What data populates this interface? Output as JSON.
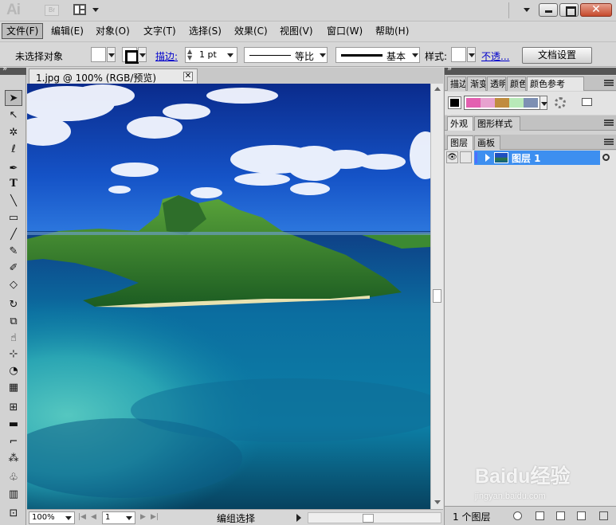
{
  "app": {
    "logo": "Ai",
    "bridge_label": "Br"
  },
  "menu": [
    {
      "label": "文件(F)",
      "active": true
    },
    {
      "label": "编辑(E)"
    },
    {
      "label": "对象(O)"
    },
    {
      "label": "文字(T)"
    },
    {
      "label": "选择(S)"
    },
    {
      "label": "效果(C)"
    },
    {
      "label": "视图(V)"
    },
    {
      "label": "窗口(W)"
    },
    {
      "label": "帮助(H)"
    }
  ],
  "control": {
    "selection_label": "未选择对象",
    "stroke_label": "描边:",
    "stroke_weight": "1 pt",
    "profile_label": "等比",
    "brush_label": "基本",
    "style_label": "样式:",
    "opacity_label": "不透...",
    "doc_setup_button": "文档设置"
  },
  "document": {
    "tab_title": "1.jpg @ 100% (RGB/预览)",
    "close_glyph": "✕"
  },
  "tools": [
    "selection-tool",
    "direct-selection-tool",
    "magic-wand-tool",
    "lasso-tool",
    "pen-tool",
    "type-tool",
    "line-tool",
    "rectangle-tool",
    "paintbrush-tool",
    "pencil-tool",
    "blob-brush-tool",
    "eraser-tool",
    "rotate-tool",
    "scale-tool",
    "warp-tool",
    "free-transform-tool",
    "shape-builder-tool",
    "perspective-grid-tool",
    "mesh-tool",
    "gradient-tool",
    "eyedropper-tool",
    "blend-tool",
    "symbol-sprayer-tool",
    "column-graph-tool",
    "artboard-tool"
  ],
  "status": {
    "zoom": "100%",
    "artboard": "1",
    "mode_label": "编组选择"
  },
  "panels": {
    "top_tabs": [
      "描边",
      "渐变",
      "透明",
      "颜色",
      "颜色参考"
    ],
    "second_tabs": [
      "外观",
      "图形样式"
    ],
    "layer_tabs": [
      "图层",
      "画板"
    ],
    "guide_colors": [
      "#e35fb0",
      "#e7a2cf",
      "#c08c3f",
      "#b8e9b8",
      "#7d8fb3"
    ],
    "layer_name": "图层 1",
    "layer_count": "1 个图层"
  },
  "watermark": {
    "brand": "Baidu经验",
    "url": "jingyan.baidu.com"
  }
}
